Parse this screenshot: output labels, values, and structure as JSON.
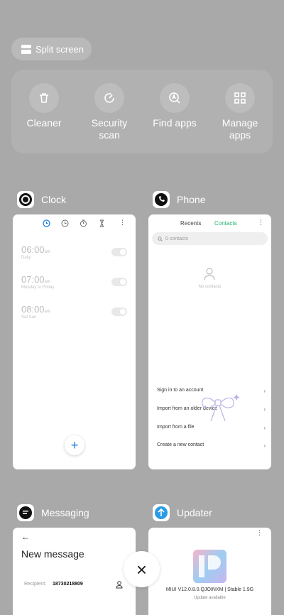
{
  "split_screen": {
    "label": "Split screen"
  },
  "quick_actions": [
    {
      "label": "Cleaner",
      "icon": "trash-icon"
    },
    {
      "label": "Security\nscan",
      "icon": "security-scan-icon"
    },
    {
      "label": "Find apps",
      "icon": "find-apps-icon"
    },
    {
      "label": "Manage\napps",
      "icon": "grid-icon"
    }
  ],
  "apps": {
    "clock": {
      "name": "Clock",
      "alarms": [
        {
          "time": "06:00",
          "ampm": "am",
          "repeat": "Daily"
        },
        {
          "time": "07:00",
          "ampm": "am",
          "repeat": "Monday to Friday"
        },
        {
          "time": "08:00",
          "ampm": "am",
          "repeat": "Sat Sun"
        }
      ],
      "add_label": "+"
    },
    "phone": {
      "name": "Phone",
      "tabs": [
        "Recents",
        "Contacts"
      ],
      "search_placeholder": "0 contacts",
      "empty_label": "No contacts",
      "actions": [
        "Sign in to an account",
        "Import from an older device",
        "Import from a file",
        "Create a new contact"
      ]
    },
    "messaging": {
      "name": "Messaging",
      "title": "New message",
      "recipient_label": "Recipient:",
      "recipient_value": "18730218809"
    },
    "updater": {
      "name": "Updater",
      "version": "MIUI V12.0.8.0.QJOINXM | Stable 1.9G",
      "status": "Update available"
    }
  },
  "close_label": "×",
  "colors": {
    "accent_blue": "#1a7fe6",
    "accent_green": "#1fb36b"
  }
}
